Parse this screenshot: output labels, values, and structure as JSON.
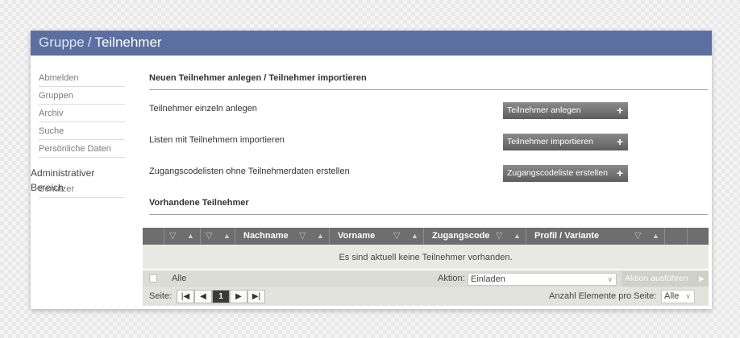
{
  "header": {
    "crumb": "Gruppe",
    "separator": "/",
    "title": "Teilnehmer"
  },
  "sidebar": {
    "items": [
      "Abmelden",
      "Gruppen",
      "Archiv",
      "Suche",
      "Persönliche Daten"
    ],
    "admin_section": "Administrativer Bereich",
    "admin_items": [
      "Benutzer"
    ]
  },
  "create_section": {
    "heading": "Neuen Teilnehmer anlegen / Teilnehmer importieren",
    "rows": [
      {
        "label": "Teilnehmer einzeln anlegen",
        "button": "Teilnehmer anlegen"
      },
      {
        "label": "Listen mit Teilnehmern importieren",
        "button": "Teilnehmer importieren"
      },
      {
        "label": "Zugangscodelisten ohne Teilnehmerdaten erstellen",
        "button": "Zugangscodeliste erstellen"
      }
    ],
    "button_icon": "+"
  },
  "existing_section": {
    "heading": "Vorhandene Teilnehmer",
    "columns": [
      "Nachname",
      "Vorname",
      "Zugangscode",
      "Profil / Variante"
    ],
    "empty_message": "Es sind aktuell keine Teilnehmer vorhanden.",
    "select_all_label": "Alle",
    "action_label": "Aktion:",
    "action_value": "Einladen",
    "action_button": "Aktion ausführen",
    "page_label": "Seite:",
    "current_page": "1",
    "page_size_label": "Anzahl Elemente pro Seite:",
    "page_size_value": "Alle"
  },
  "icons": {
    "filter": "filter-icon",
    "sort": "sort-caret-icon"
  },
  "colors": {
    "header_bg": "#5b6fa1",
    "button_bg": "#6b6b6b",
    "table_header_bg": "#6e6e6e"
  }
}
